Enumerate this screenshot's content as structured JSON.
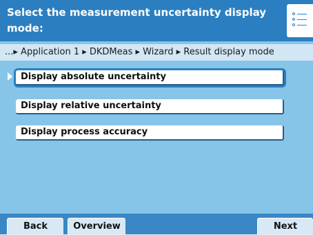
{
  "header": {
    "title": "Select the measurement uncertainty display mode:",
    "menu_icon": "list-menu-icon"
  },
  "breadcrumb": {
    "text": "...▸ Application 1 ▸ DKDMeas ▸ Wizard ▸ Result display mode"
  },
  "options": [
    {
      "label": "Display absolute uncertainty",
      "selected": true
    },
    {
      "label": "Display relative uncertainty",
      "selected": false
    },
    {
      "label": "Display process accuracy",
      "selected": false
    }
  ],
  "footer": {
    "back_label": "Back",
    "overview_label": "Overview",
    "next_label": "Next"
  },
  "colors": {
    "header_bg": "#2b7fc0",
    "screen_bg": "#86c5e8",
    "breadcrumb_bg": "#d2e6f4",
    "footer_bg": "#3a87c5"
  }
}
